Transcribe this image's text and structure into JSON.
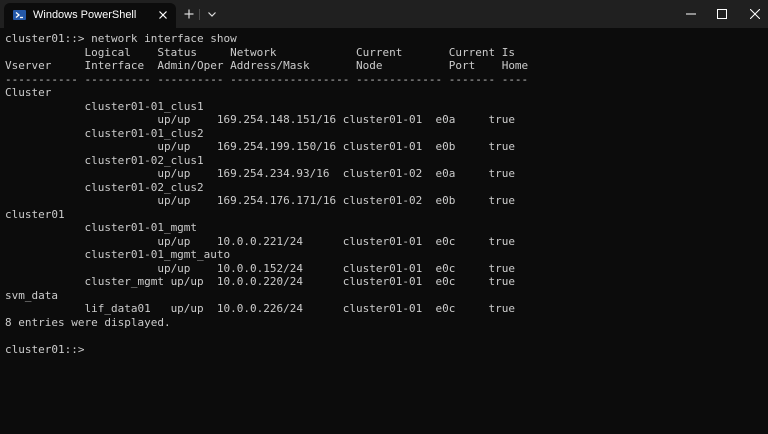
{
  "window": {
    "tab_title": "Windows PowerShell",
    "tab_icon": "powershell-icon",
    "close_tab_icon": "close-icon",
    "new_tab_icon": "plus-icon",
    "dropdown_icon": "chevron-down-icon",
    "minimize_icon": "minimize-icon",
    "maximize_icon": "maximize-icon",
    "close_window_icon": "close-icon"
  },
  "colors": {
    "background": "#0c0c0c",
    "titlebar": "#202020",
    "text": "#cccccc",
    "icon_accent": "#2458a8"
  },
  "terminal": {
    "lines": [
      "cluster01::> network interface show",
      "            Logical    Status     Network            Current       Current Is",
      "Vserver     Interface  Admin/Oper Address/Mask       Node          Port    Home",
      "----------- ---------- ---------- ------------------ ------------- ------- ----",
      "Cluster",
      "            cluster01-01_clus1",
      "                       up/up    169.254.148.151/16 cluster01-01  e0a     true",
      "            cluster01-01_clus2",
      "                       up/up    169.254.199.150/16 cluster01-01  e0b     true",
      "            cluster01-02_clus1",
      "                       up/up    169.254.234.93/16  cluster01-02  e0a     true",
      "            cluster01-02_clus2",
      "                       up/up    169.254.176.171/16 cluster01-02  e0b     true",
      "cluster01",
      "            cluster01-01_mgmt",
      "                       up/up    10.0.0.221/24      cluster01-01  e0c     true",
      "            cluster01-01_mgmt_auto",
      "                       up/up    10.0.0.152/24      cluster01-01  e0c     true",
      "            cluster_mgmt up/up  10.0.0.220/24      cluster01-01  e0c     true",
      "svm_data",
      "            lif_data01   up/up  10.0.0.226/24      cluster01-01  e0c     true",
      "8 entries were displayed.",
      "",
      "cluster01::>"
    ]
  }
}
